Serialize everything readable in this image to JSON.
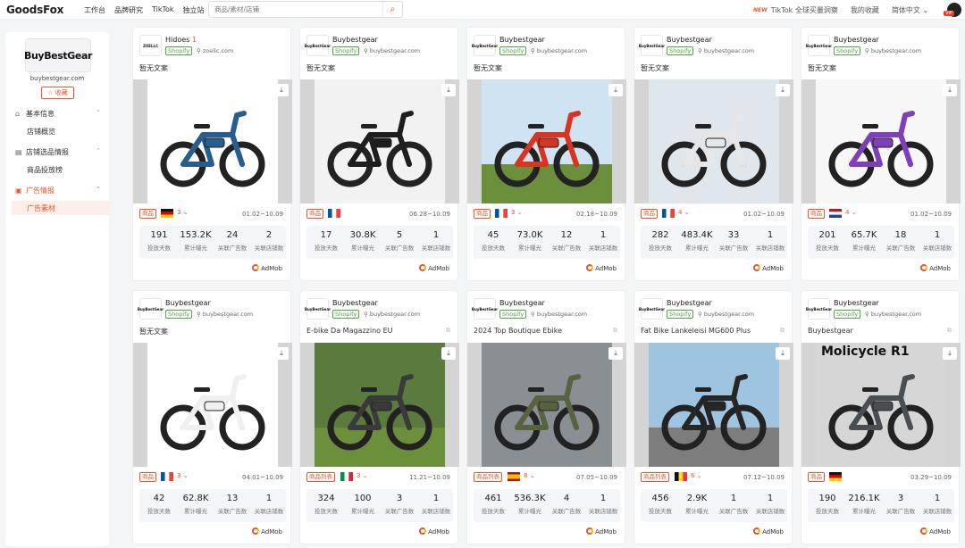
{
  "app": {
    "logo": "GoodsFox",
    "nav": [
      "工作台",
      "品牌研究",
      "TikTok",
      "独立站"
    ],
    "search_placeholder": "商品/素材/店铺",
    "new_badge": "NEW",
    "right_nav": [
      "TikTok 全球买量洞察",
      "我的收藏",
      "简体中文"
    ],
    "vip": "VIP"
  },
  "sidebar": {
    "shop_logo": "BuyBestGear",
    "shop_domain": "buybestgear.com",
    "fav_label": "☆ 收藏",
    "groups": [
      {
        "label": "基本信息",
        "items": [
          "店铺概览"
        ]
      },
      {
        "label": "店铺选品情报",
        "items": [
          "商品投放榜"
        ]
      },
      {
        "label": "广告情报",
        "items": [
          "广告素材"
        ]
      }
    ]
  },
  "stat_labels": [
    "投放天数",
    "累计曝光",
    "关联广告数",
    "关联店铺数"
  ],
  "network": "AdMob",
  "cards": [
    {
      "brand": "Hidoes",
      "brand_count": "1",
      "brand_logo": "ZOELLC",
      "platform": "Shopify",
      "domain": "zoellc.com",
      "title": "暂无文案",
      "tag": "商品",
      "flag": "de",
      "count": "3",
      "date": "01.02~10.09",
      "stats": [
        "191",
        "153.2K",
        "24",
        "2"
      ],
      "bike": "#2a5d8f"
    },
    {
      "brand": "Buybestgear",
      "brand_count": "",
      "brand_logo": "BuyBestGear",
      "platform": "Shopify",
      "domain": "buybestgear.com",
      "title": "暂无文案",
      "tag": "商品",
      "flag": "fr",
      "count": "",
      "date": "06.28~10.09",
      "stats": [
        "17",
        "30.8K",
        "5",
        "1"
      ],
      "bike": "#1d1d1d"
    },
    {
      "brand": "Buybestgear",
      "brand_count": "",
      "brand_logo": "BuyBestGear",
      "platform": "Shopify",
      "domain": "buybestgear.com",
      "title": "暂无文案",
      "tag": "商品",
      "flag": "fr",
      "count": "3",
      "date": "02.18~10.09",
      "stats": [
        "45",
        "73.0K",
        "12",
        "1"
      ],
      "bike": "#d9341f"
    },
    {
      "brand": "Buybestgear",
      "brand_count": "",
      "brand_logo": "BuyBestGear",
      "platform": "Shopify",
      "domain": "buybestgear.com",
      "title": "暂无文案",
      "tag": "商品",
      "flag": "fr",
      "count": "4",
      "date": "01.02~10.09",
      "stats": [
        "282",
        "483.4K",
        "33",
        "1"
      ],
      "bike": "#e6e6e6"
    },
    {
      "brand": "Buybestgear",
      "brand_count": "",
      "brand_logo": "BuyBestGear",
      "platform": "Shopify",
      "domain": "buybestgear.com",
      "title": "暂无文案",
      "tag": "商品",
      "flag": "nl",
      "count": "4",
      "date": "01.02~10.09",
      "stats": [
        "201",
        "65.7K",
        "18",
        "1"
      ],
      "bike": "#7e3fb8"
    },
    {
      "brand": "Buybestgear",
      "brand_count": "",
      "brand_logo": "BuyBestGear",
      "platform": "Shopify",
      "domain": "buybestgear.com",
      "title": "暂无文案",
      "tag": "商品",
      "flag": "fr",
      "count": "3",
      "date": "04.01~10.09",
      "stats": [
        "42",
        "62.8K",
        "13",
        "1"
      ],
      "bike": "#f0f0f0"
    },
    {
      "brand": "Buybestgear",
      "brand_count": "",
      "brand_logo": "BuyBestGear",
      "platform": "Shopify",
      "domain": "buybestgear.com",
      "title": "E-bike Da Magazzino EU",
      "tag": "商品列表",
      "flag": "it",
      "count": "3",
      "date": "11.21~10.09",
      "stats": [
        "324",
        "100",
        "3",
        "1"
      ],
      "bike": "#3a3a3a"
    },
    {
      "brand": "Buybestgear",
      "brand_count": "",
      "brand_logo": "BuyBestGear",
      "platform": "Shopify",
      "domain": "buybestgear.com",
      "title": "2024 Top Boutique Ebike",
      "tag": "商品列表",
      "flag": "es",
      "count": "8",
      "date": "07.05~10.09",
      "stats": [
        "461",
        "536.3K",
        "4",
        "1"
      ],
      "bike": "#55633f"
    },
    {
      "brand": "Buybestgear",
      "brand_count": "",
      "brand_logo": "BuyBestGear",
      "platform": "Shopify",
      "domain": "buybestgear.com",
      "title": "Fat Bike Lankeleisi MG600 Plus",
      "tag": "商品列表",
      "flag": "be",
      "count": "6",
      "date": "07.12~10.09",
      "stats": [
        "456",
        "2.9K",
        "1",
        "1"
      ],
      "bike": "#262626"
    },
    {
      "brand": "Buybestgear",
      "brand_count": "",
      "brand_logo": "BuyBestGear",
      "platform": "Shopify",
      "domain": "buybestgear.com",
      "title": "Buybestgear",
      "tag": "商品",
      "flag": "de",
      "count": "",
      "date": "03.29~10.09",
      "stats": [
        "190",
        "216.1K",
        "3",
        "1"
      ],
      "bike": "#4a4e52",
      "overlay": "Molicycle R1"
    }
  ]
}
